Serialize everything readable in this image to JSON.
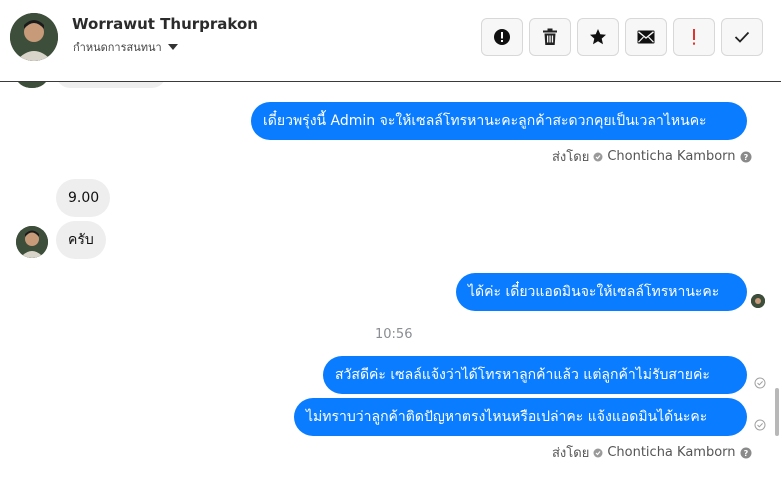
{
  "header": {
    "contact_name": "Worrawut Thurprakon",
    "subtitle": "กำหนดการสนทนา",
    "actions": [
      {
        "name": "report-button",
        "icon": "alert-circle-icon"
      },
      {
        "name": "delete-button",
        "icon": "trash-icon"
      },
      {
        "name": "star-button",
        "icon": "star-icon"
      },
      {
        "name": "mail-button",
        "icon": "envelope-icon"
      },
      {
        "name": "important-button",
        "icon": "exclamation-icon",
        "color": "#e0342f"
      },
      {
        "name": "done-button",
        "icon": "checkmark-icon"
      }
    ]
  },
  "messages": {
    "m1": "เดี๋ยวพรุ่งนี้ Admin จะให้เซลล์โทรหานะคะลูกค้าสะดวกคุยเป็นเวลาไหนคะ",
    "m1_sent_prefix": "ส่งโดย",
    "m1_sent_by": "Chonticha Kamborn",
    "m2": "9.00",
    "m3": "ครับ",
    "m4": "ได้ค่ะ เดี๋ยวแอดมินจะให้เซลล์โทรหานะคะ",
    "time": "10:56",
    "m5": "สวัสดีค่ะ เซลล์แจ้งว่าได้โทรหาลูกค้าแล้ว แต่ลูกค้าไม่รับสายค่ะ",
    "m6": "ไม่ทราบว่าลูกค้าติดปัญหาตรงไหนหรือเปล่าคะ แจ้งแอดมินได้นะคะ",
    "m6_sent_prefix": "ส่งโดย",
    "m6_sent_by": "Chonticha Kamborn"
  },
  "colors": {
    "outgoing_bubble": "#0a7cff",
    "incoming_bubble": "#eeeeee",
    "accent_red": "#e0342f"
  }
}
